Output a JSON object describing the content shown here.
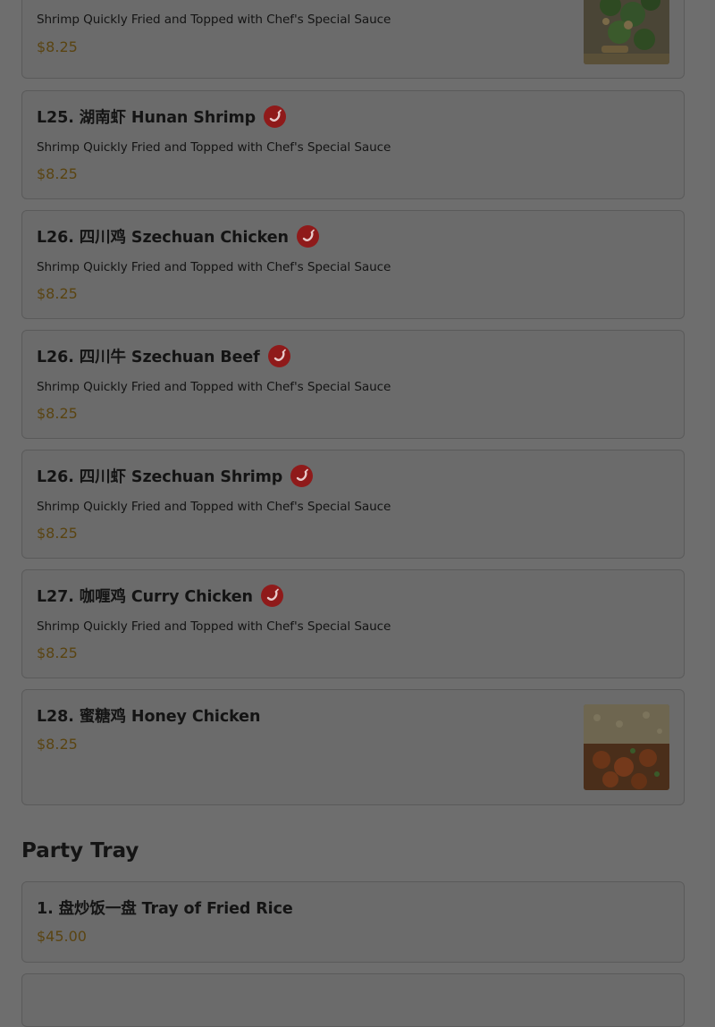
{
  "items": [
    {
      "name": "",
      "description": "Shrimp Quickly Fried and Topped with Chef's Special Sauce",
      "price": "$8.25",
      "spicy": false,
      "image": "food-photo-broccoli-dish"
    },
    {
      "name": "L25. 湖南虾 Hunan Shrimp",
      "description": "Shrimp Quickly Fried and Topped with Chef's Special Sauce",
      "price": "$8.25",
      "spicy": true
    },
    {
      "name": "L26. 四川鸡 Szechuan Chicken",
      "description": "Shrimp Quickly Fried and Topped with Chef's Special Sauce",
      "price": "$8.25",
      "spicy": true
    },
    {
      "name": "L26. 四川牛 Szechuan Beef",
      "description": "Shrimp Quickly Fried and Topped with Chef's Special Sauce",
      "price": "$8.25",
      "spicy": true
    },
    {
      "name": "L26. 四川虾 Szechuan Shrimp",
      "description": "Shrimp Quickly Fried and Topped with Chef's Special Sauce",
      "price": "$8.25",
      "spicy": true
    },
    {
      "name": "L27. 咖喱鸡 Curry Chicken",
      "description": "Shrimp Quickly Fried and Topped with Chef's Special Sauce",
      "price": "$8.25",
      "spicy": true
    },
    {
      "name": "L28. 蜜糖鸡 Honey Chicken",
      "description": "",
      "price": "$8.25",
      "spicy": false,
      "image": "food-photo-honey-chicken"
    }
  ],
  "party_tray": {
    "title": "Party Tray",
    "items": [
      {
        "name": "1. 盘炒饭一盘 Tray of Fried Rice",
        "price": "$45.00"
      }
    ]
  },
  "colors": {
    "overlay_background": "#6e6e6e",
    "spicy_icon": "#8f1a1a",
    "price_text": "#5a4412"
  },
  "icons": {
    "spicy": "chili-pepper-icon"
  }
}
